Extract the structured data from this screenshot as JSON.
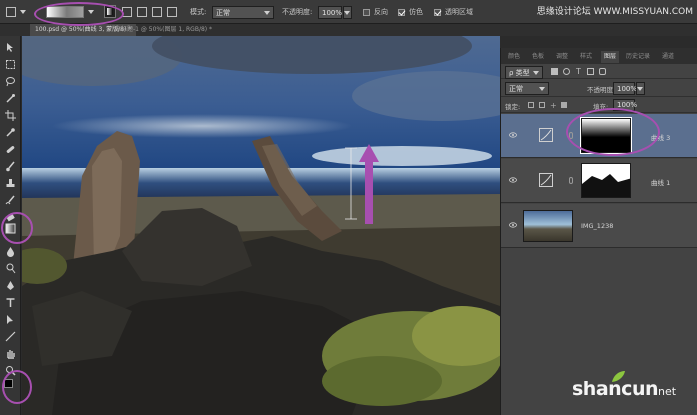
{
  "watermark": "思缘设计论坛 WWW.MISSYUAN.COM",
  "options_bar": {
    "mode_label": "模式:",
    "mode_value": "正常",
    "opacity_label": "不透明度:",
    "opacity_value": "100%",
    "reverse_label": "反向",
    "dither_label": "仿色",
    "transparency_label": "透明区域",
    "reverse_checked": false,
    "dither_checked": true,
    "transparency_checked": true
  },
  "document_tabs": [
    {
      "label": "100.psd @ 50%(曲线 3, 蒙版/8) *"
    },
    {
      "label": "未标题-1 @ 50%(图层 1, RGB/8) *"
    }
  ],
  "layers_panel": {
    "tabs": [
      "颜色",
      "色板",
      "调整",
      "样式",
      "图层",
      "历史记录",
      "通道"
    ],
    "active_tab": "图层",
    "filter_kind": "ρ 类型",
    "blend_mode": "正常",
    "opacity_label": "不透明度:",
    "opacity_value": "100%",
    "lock_label": "锁定:",
    "fill_label": "填充:",
    "fill_value": "100%",
    "layers": [
      {
        "name": "曲线 3",
        "type": "adjustment",
        "mask": "black-to-white-gradient",
        "selected": true
      },
      {
        "name": "曲线 1",
        "type": "adjustment",
        "mask": "landscape-silhouette",
        "selected": false
      },
      {
        "name": "IMG_1238",
        "type": "image",
        "selected": false
      }
    ]
  },
  "branding": {
    "site": "shancun",
    "site_suffix": "net"
  },
  "colors": {
    "annotation_ring": "#a74fb0",
    "selected_layer": "#5b6f8f",
    "panel_bg": "#434343"
  }
}
